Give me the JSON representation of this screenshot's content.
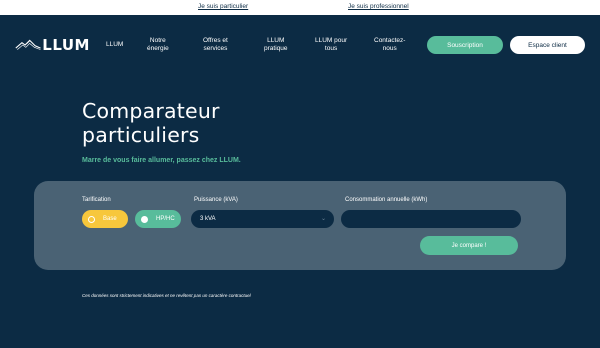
{
  "topbar": {
    "particulier_link": "Je suis particulier",
    "professionnel_link": "Je suis professionnel"
  },
  "brand": {
    "name": "LLUM"
  },
  "nav": {
    "items": [
      {
        "label": "LLUM"
      },
      {
        "label": "Notre\nénergie"
      },
      {
        "label": "Offres et\nservices"
      },
      {
        "label": "LLUM\npratique"
      },
      {
        "label": "LLUM pour\ntous"
      },
      {
        "label": "Contactez-\nnous"
      }
    ],
    "subscribe_label": "Souscription",
    "client_label": "Espace client"
  },
  "hero": {
    "title": "Comparateur\nparticuliers",
    "tagline": "Marre de vous faire allumer, passez chez LLUM."
  },
  "form": {
    "tarification_label": "Tarification",
    "options": [
      {
        "label": "Base",
        "selected": true
      },
      {
        "label": "HP/HC",
        "selected": false
      }
    ],
    "puissance_label": "Puissance (kVA)",
    "puissance_value": "3 kVA",
    "consommation_label": "Consommation annuelle (kWh)",
    "consommation_value": "",
    "compare_label": "Je compare !"
  },
  "footer": {
    "disclaimer": "Ces données sont strictement indicatives et ne revêtent pas un caractère contractuel"
  },
  "colors": {
    "background": "#0c2b44",
    "accent_green": "#58bc9b",
    "accent_yellow": "#f7c73c",
    "panel": "#4a6274"
  },
  "icons": {
    "logo": "mountain-logo-icon",
    "select_chevron": "chevron-down-icon"
  }
}
